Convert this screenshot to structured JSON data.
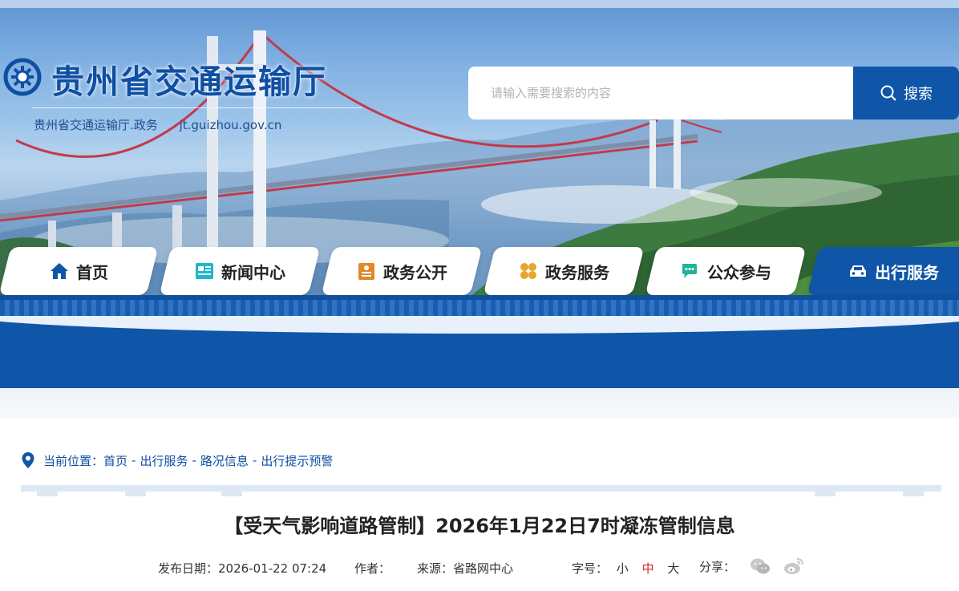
{
  "site": {
    "title": "贵州省交通运输厅",
    "sub_name": "贵州省交通运输厅.政务",
    "sub_domain": "jt.guizhou.gov.cn"
  },
  "search": {
    "placeholder": "请输入需要搜索的内容",
    "button_label": "搜索"
  },
  "nav": [
    {
      "label": "首页",
      "icon": "home-icon",
      "active": false
    },
    {
      "label": "新闻中心",
      "icon": "news-icon",
      "active": false
    },
    {
      "label": "政务公开",
      "icon": "document-icon",
      "active": false
    },
    {
      "label": "政务服务",
      "icon": "grid-icon",
      "active": false
    },
    {
      "label": "公众参与",
      "icon": "chat-icon",
      "active": false
    },
    {
      "label": "出行服务",
      "icon": "car-icon",
      "active": true
    }
  ],
  "breadcrumb": {
    "prefix": "当前位置：",
    "items": [
      "首页",
      "出行服务",
      "路况信息",
      "出行提示预警"
    ],
    "separator": "-"
  },
  "article": {
    "title": "【受天气影响道路管制】2026年1月22日7时凝冻管制信息",
    "date_label": "发布日期：",
    "date": "2026-01-22 07:24",
    "author_label": "作者：",
    "author": "",
    "source_label": "来源：",
    "source": "省路网中心",
    "font_label": "字号：",
    "font_sizes": [
      "小",
      "中",
      "大"
    ],
    "font_selected": "中",
    "share_label": "分享："
  },
  "colors": {
    "primary": "#0f56a9",
    "title_blue": "#0e4fa3",
    "active_font": "#d32b2b"
  }
}
